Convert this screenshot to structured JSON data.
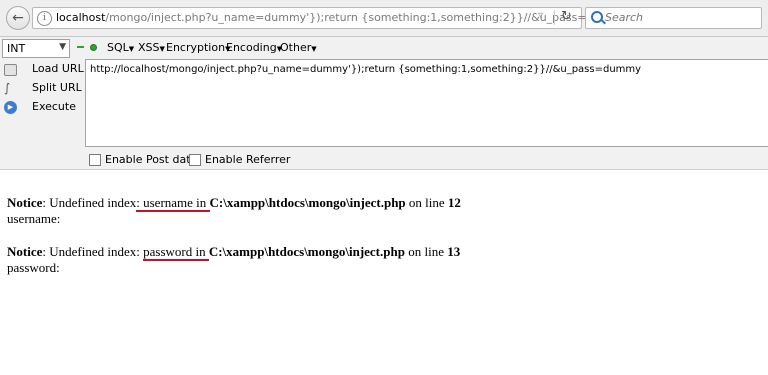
{
  "browser": {
    "url_host": "localhost",
    "url_path": "/mongo/inject.php?u_name=dummy'});return {something:1,something:2}}//&u_pass=dummy",
    "search_placeholder": "Search",
    "back_glyph": "←",
    "reload_glyph": "↻",
    "dropdown_glyph": "▿",
    "info_glyph": "i"
  },
  "hackbar": {
    "select_value": "INT",
    "menus": [
      "SQL",
      "XSS",
      "Encryption",
      "Encoding",
      "Other"
    ],
    "buttons": {
      "load": "Load URL",
      "split": "Split URL",
      "execute": "Execute"
    },
    "textarea_value": "http://localhost/mongo/inject.php?u_name=dummy'});return {something:1,something:2}}//&u_pass=dummy",
    "checkboxes": {
      "post": "Enable Post data",
      "referrer": "Enable Referrer"
    }
  },
  "page": {
    "notices": [
      {
        "label": "Notice",
        "msg": ": Undefined index",
        "index": ": username",
        "in_word": " in ",
        "path": "C:\\xampp\\htdocs\\mongo\\inject.php",
        "on_line": " on line ",
        "line_no": "12",
        "output": "username:"
      },
      {
        "label": "Notice",
        "msg": ": Undefined index: ",
        "index": "password",
        "in_word": " in ",
        "path": "C:\\xampp\\htdocs\\mongo\\inject.php",
        "on_line": " on line ",
        "line_no": "13",
        "output": "password:"
      }
    ]
  },
  "colors": {
    "underline": "#c8102e",
    "accent_blue": "#2d6fc3",
    "dot_green": "#2ea52e"
  }
}
